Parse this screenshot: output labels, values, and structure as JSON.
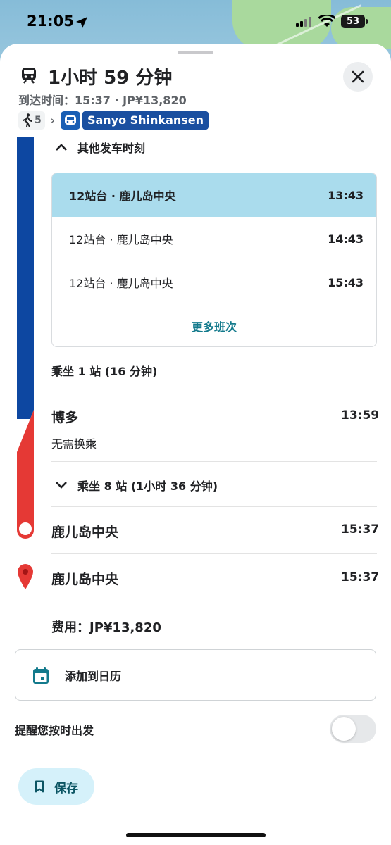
{
  "status_bar": {
    "time": "21:05",
    "battery": "53"
  },
  "header": {
    "title": "1小时 59 分钟",
    "subtitle": "到达时间：15:37 · JP¥13,820",
    "walk_minutes": "5",
    "line_name": "Sanyo Shinkansen"
  },
  "departures": {
    "toggle_label": "其他发车时刻",
    "rows": [
      {
        "label": "12站台 · 鹿儿岛中央",
        "time": "13:43",
        "selected": true
      },
      {
        "label": "12站台 · 鹿儿岛中央",
        "time": "14:43",
        "selected": false
      },
      {
        "label": "12站台 · 鹿儿岛中央",
        "time": "15:43",
        "selected": false
      }
    ],
    "more_label": "更多班次"
  },
  "segment1": {
    "ride_label": "乘坐 1 站 (16 分钟)"
  },
  "transfer": {
    "station": "博多",
    "time": "13:59",
    "note": "无需换乘"
  },
  "segment2": {
    "ride_label": "乘坐 8 站 (1小时 36 分钟)"
  },
  "arrival": {
    "station": "鹿儿岛中央",
    "time": "15:37"
  },
  "destination": {
    "station": "鹿儿岛中央",
    "time": "15:37"
  },
  "fare": {
    "label": "费用：JP¥13,820"
  },
  "calendar": {
    "label": "添加到日历"
  },
  "reminder": {
    "label": "提醒您按时出发",
    "enabled": false
  },
  "save": {
    "label": "保存"
  },
  "colors": {
    "line_blue": "#0d47a1",
    "line_red": "#e53935",
    "accent_teal": "#137a8c",
    "selected_row": "#aadced"
  }
}
